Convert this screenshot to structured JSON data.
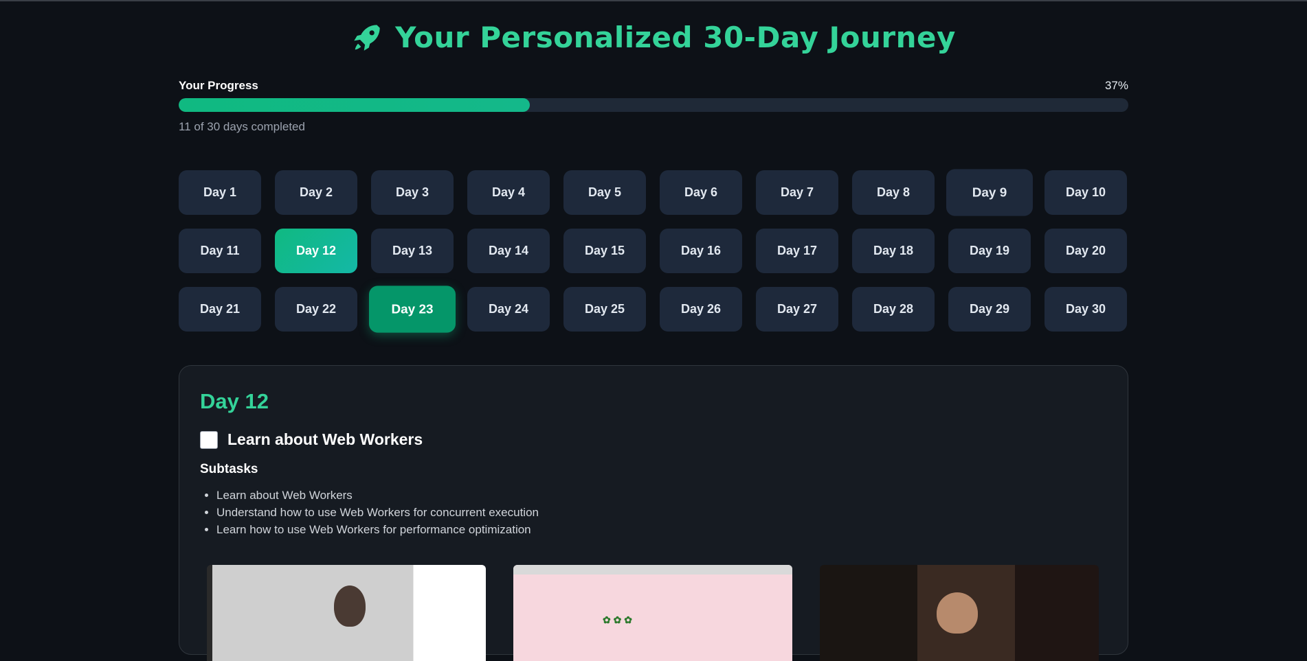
{
  "header": {
    "title": "Your Personalized 30-Day Journey",
    "icon": "rocket-icon",
    "accent_color": "#34d399"
  },
  "progress": {
    "label": "Your Progress",
    "percent_text": "37%",
    "percent": 37,
    "completed_text": "11 of 30 days completed"
  },
  "days": [
    {
      "label": "Day 1"
    },
    {
      "label": "Day 2"
    },
    {
      "label": "Day 3"
    },
    {
      "label": "Day 4"
    },
    {
      "label": "Day 5"
    },
    {
      "label": "Day 6"
    },
    {
      "label": "Day 7"
    },
    {
      "label": "Day 8"
    },
    {
      "label": "Day 9"
    },
    {
      "label": "Day 10"
    },
    {
      "label": "Day 11"
    },
    {
      "label": "Day 12"
    },
    {
      "label": "Day 13"
    },
    {
      "label": "Day 14"
    },
    {
      "label": "Day 15"
    },
    {
      "label": "Day 16"
    },
    {
      "label": "Day 17"
    },
    {
      "label": "Day 18"
    },
    {
      "label": "Day 19"
    },
    {
      "label": "Day 20"
    },
    {
      "label": "Day 21"
    },
    {
      "label": "Day 22"
    },
    {
      "label": "Day 23"
    },
    {
      "label": "Day 24"
    },
    {
      "label": "Day 25"
    },
    {
      "label": "Day 26"
    },
    {
      "label": "Day 27"
    },
    {
      "label": "Day 28"
    },
    {
      "label": "Day 29"
    },
    {
      "label": "Day 30"
    }
  ],
  "selected_day": "Day 12",
  "hovered_day": "Day 23",
  "detail": {
    "title": "Day 12",
    "task": "Learn about Web Workers",
    "task_checked": false,
    "subtasks_heading": "Subtasks",
    "subtasks": [
      "Learn about Web Workers",
      "Understand how to use Web Workers for concurrent execution",
      "Learn how to use Web Workers for performance optimization"
    ]
  }
}
